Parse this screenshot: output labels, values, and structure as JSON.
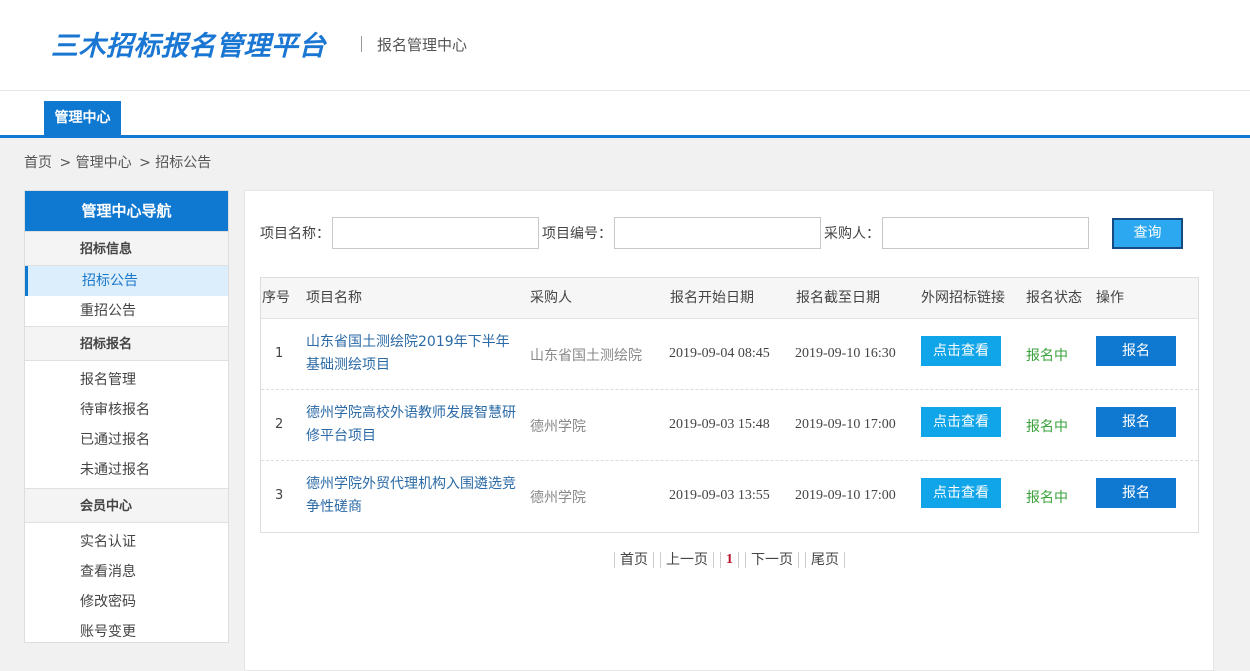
{
  "header": {
    "logo": "三木招标报名管理平台",
    "subtitle": "报名管理中心"
  },
  "nav": {
    "tab": "管理中心"
  },
  "breadcrumb": {
    "home": "首页",
    "level1": "> 管理中心",
    "level2": "> 招标公告"
  },
  "sidebar": {
    "title": "管理中心导航",
    "group1": "招标信息",
    "g1_items": [
      "招标公告",
      "重招公告"
    ],
    "group2": "招标报名",
    "g2_items": [
      "报名管理",
      "待审核报名",
      "已通过报名",
      "未通过报名"
    ],
    "group3": "会员中心",
    "g3_items": [
      "实名认证",
      "查看消息",
      "修改密码",
      "账号变更"
    ]
  },
  "search": {
    "name_label": "项目名称：",
    "code_label": "项目编号：",
    "buyer_label": "采购人：",
    "button": "查询"
  },
  "table": {
    "headers": [
      "序号",
      "项目名称",
      "采购人",
      "报名开始日期",
      "报名截至日期",
      "外网招标链接",
      "报名状态",
      "操作"
    ],
    "rows": [
      {
        "num": "1",
        "name": "山东省国土测绘院2019年下半年基础测绘项目",
        "buyer": "山东省国土测绘院",
        "start": "2019-09-04 08:45",
        "end": "2019-09-10 16:30",
        "link": "点击查看",
        "status": "报名中",
        "action": "报名"
      },
      {
        "num": "2",
        "name": "德州学院高校外语教师发展智慧研修平台项目",
        "buyer": "德州学院",
        "start": "2019-09-03 15:48",
        "end": "2019-09-10 17:00",
        "link": "点击查看",
        "status": "报名中",
        "action": "报名"
      },
      {
        "num": "3",
        "name": "德州学院外贸代理机构入围遴选竞争性磋商",
        "buyer": "德州学院",
        "start": "2019-09-03 13:55",
        "end": "2019-09-10 17:00",
        "link": "点击查看",
        "status": "报名中",
        "action": "报名"
      }
    ]
  },
  "pager": {
    "first": "首页",
    "prev": "上一页",
    "current": "1",
    "next": "下一页",
    "last": "尾页"
  }
}
